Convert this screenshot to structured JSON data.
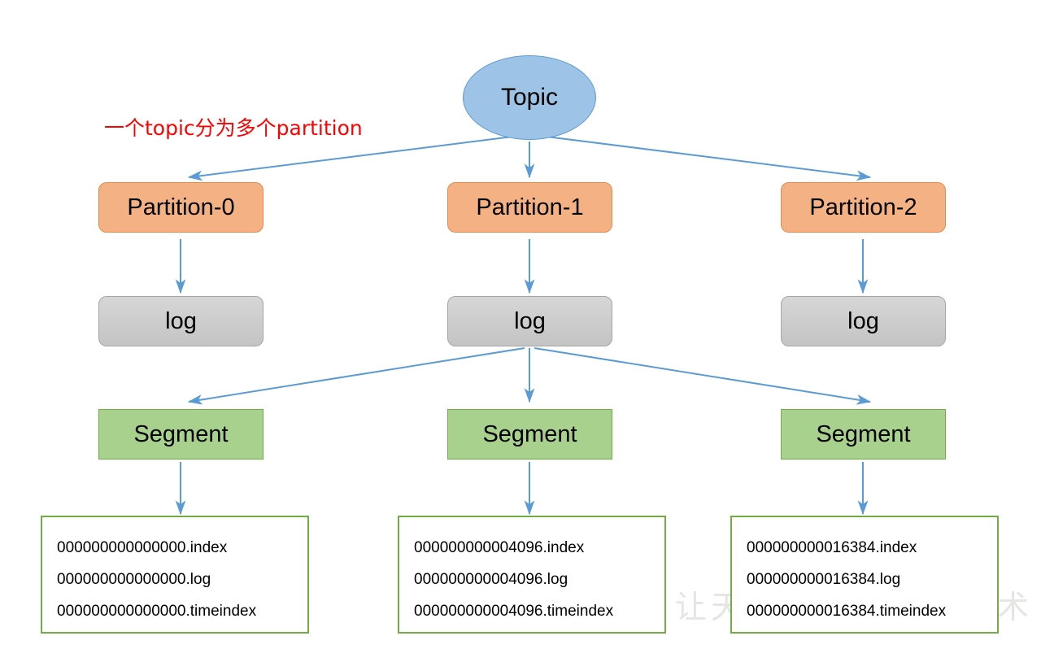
{
  "diagram": {
    "title_node": {
      "label": "Topic"
    },
    "annotation": {
      "text": "一个topic分为多个partition",
      "color": "#ff0000"
    },
    "watermark": {
      "text": "让天下没有难学的技术"
    },
    "partitions": [
      {
        "label": "Partition-0"
      },
      {
        "label": "Partition-1"
      },
      {
        "label": "Partition-2"
      }
    ],
    "logs": [
      {
        "label": "log"
      },
      {
        "label": "log"
      },
      {
        "label": "log"
      }
    ],
    "segments": [
      {
        "label": "Segment"
      },
      {
        "label": "Segment"
      },
      {
        "label": "Segment"
      }
    ],
    "file_groups": [
      {
        "files": [
          "000000000000000.index",
          "000000000000000.log",
          "000000000000000.timeindex"
        ]
      },
      {
        "files": [
          "000000000004096.index",
          "000000000004096.log",
          "000000000004096.timeindex"
        ]
      },
      {
        "files": [
          "000000000016384.index",
          "000000000016384.log",
          "000000000016384.timeindex"
        ]
      }
    ],
    "colors": {
      "topic_fill": "#9dc3e6",
      "topic_stroke": "#5b9bd5",
      "partition_fill": "#f4b183",
      "partition_stroke": "#e08b4e",
      "log_fill": "#c9c9c9",
      "log_stroke": "#a6a6a6",
      "segment_fill": "#a9d18e",
      "segment_stroke": "#70ad47",
      "arrow": "#5b9bd5",
      "annotation": "#ff0000"
    }
  }
}
